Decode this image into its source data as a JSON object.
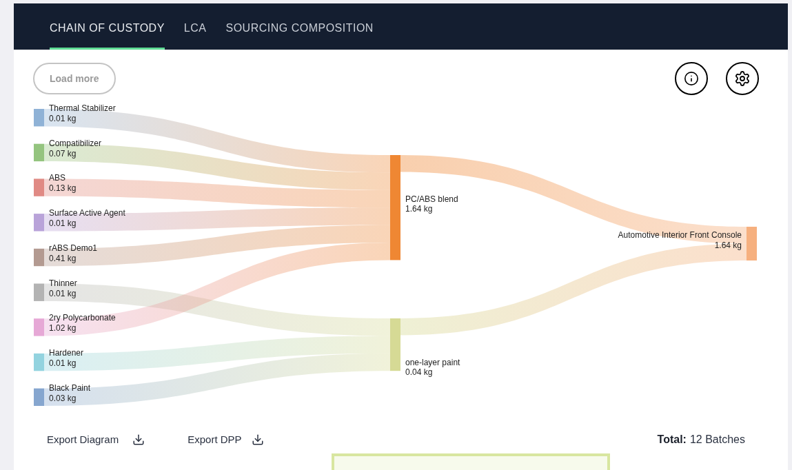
{
  "tabs": [
    {
      "label": "CHAIN OF CUSTODY",
      "selected": true
    },
    {
      "label": "LCA",
      "selected": false
    },
    {
      "label": "SOURCING COMPOSITION",
      "selected": false
    }
  ],
  "load_more": "Load more",
  "diagram": {
    "inputs": [
      {
        "name": "Thermal Stabilizer",
        "weight": "0.01 kg",
        "color": "#8fb2d6"
      },
      {
        "name": "Compatibilizer",
        "weight": "0.07 kg",
        "color": "#94c47f"
      },
      {
        "name": "ABS",
        "weight": "0.13 kg",
        "color": "#e08a84"
      },
      {
        "name": "Surface Active Agent",
        "weight": "0.01 kg",
        "color": "#b9a3d9"
      },
      {
        "name": "rABS Demo1",
        "weight": "0.41 kg",
        "color": "#b39a91"
      },
      {
        "name": "Thinner",
        "weight": "0.01 kg",
        "color": "#b3b3b3"
      },
      {
        "name": "2ry Polycarbonate",
        "weight": "1.02 kg",
        "color": "#e6a8d6"
      },
      {
        "name": "Hardener",
        "weight": "0.01 kg",
        "color": "#93d3df"
      },
      {
        "name": "Black Paint",
        "weight": "0.03 kg",
        "color": "#86a6cf"
      }
    ],
    "intermediates": [
      {
        "name": "PC/ABS blend",
        "weight": "1.64 kg",
        "color": "#ef8733"
      },
      {
        "name": "one-layer paint",
        "weight": "0.04 kg",
        "color": "#d6da95"
      }
    ],
    "product": {
      "name": "Automotive Interior Front Console",
      "weight": "1.64 kg",
      "color": "#f6b07f"
    }
  },
  "footer": {
    "export_diagram": "Export Diagram",
    "export_dpp": "Export DPP",
    "total_label": "Total:",
    "total_value": "12 Batches"
  }
}
